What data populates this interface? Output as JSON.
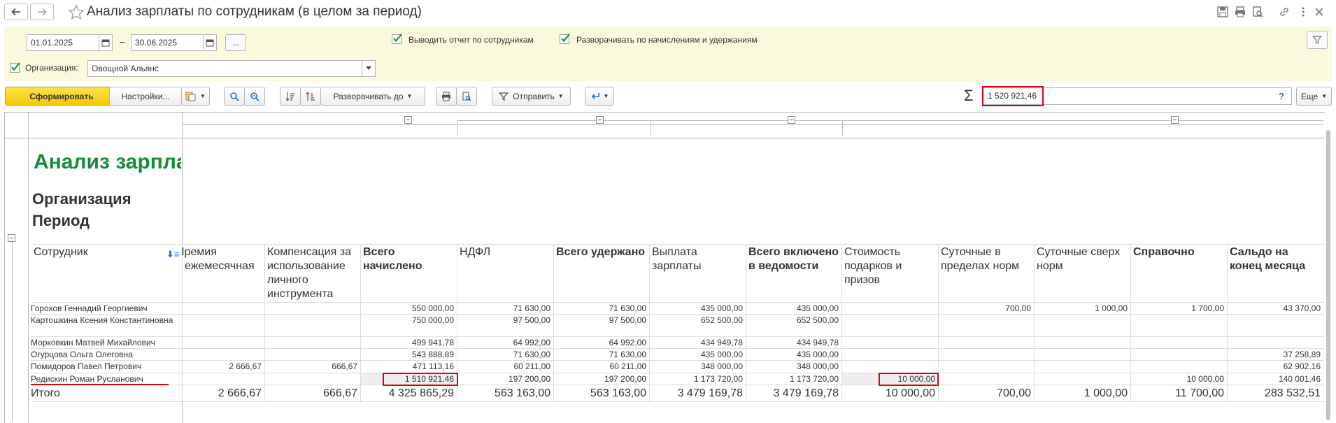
{
  "window": {
    "title": "Анализ зарплаты по сотрудникам (в целом за период)"
  },
  "params": {
    "date_from": "01.01.2025",
    "dash": "–",
    "date_to": "30.06.2025",
    "period_btn": "...",
    "by_employees": {
      "label": "Выводить отчет по сотрудникам",
      "checked": true
    },
    "expand_accruals": {
      "label": "Разворачивать по начислениям и удержаниям",
      "checked": true
    },
    "organization": {
      "label": "Организация:",
      "checked": true,
      "value": "Овощной Альянс"
    }
  },
  "toolbar": {
    "generate": "Сформировать",
    "settings": "Настройки...",
    "expand_to": "Разворачивать до",
    "send": "Отправить",
    "more": "Еще",
    "sum_symbol": "Σ",
    "sum_value": "1 520 921,46",
    "help": "?"
  },
  "report": {
    "title": "Анализ зарпла",
    "org_label": "Организация",
    "period_label": "Период",
    "columns": [
      "Сотрудник",
      "Премия ежемесячная",
      "Компенсация за использование личного инструмента",
      "Всего начислено",
      "НДФЛ",
      "Всего удержано",
      "Выплата зарплаты",
      "Всего включено в ведомости",
      "Стоимость подарков и призов",
      "Суточные в пределах норм",
      "Суточные сверх норм",
      "Справочно",
      "Сальдо на конец месяца"
    ],
    "bold_columns": [
      3,
      5,
      7,
      11,
      12
    ],
    "rows": [
      {
        "name": "Горохов Геннадий Георгиевич",
        "values": [
          "",
          "",
          "550 000,00",
          "71 630,00",
          "71 630,00",
          "435 000,00",
          "435 000,00",
          "",
          "700,00",
          "1 000,00",
          "1 700,00",
          "43 370,00"
        ]
      },
      {
        "name": "Картошкина Ксения Константиновна",
        "values": [
          "",
          "",
          "750 000,00",
          "97 500,00",
          "97 500,00",
          "652 500,00",
          "652 500,00",
          "",
          "",
          "",
          "",
          ""
        ]
      },
      {
        "name": "Морковкин Матвей Михайлович",
        "values": [
          "",
          "",
          "499 941,78",
          "64 992,00",
          "64 992,00",
          "434 949,78",
          "434 949,78",
          "",
          "",
          "",
          "",
          ""
        ]
      },
      {
        "name": "Огурцова Ольга Олеговна",
        "values": [
          "",
          "",
          "543 888,89",
          "71 630,00",
          "71 630,00",
          "435 000,00",
          "435 000,00",
          "",
          "",
          "",
          "",
          "37 258,89"
        ]
      },
      {
        "name": "Помидоров Павел Петрович",
        "values": [
          "2 666,67",
          "666,67",
          "471 113,16",
          "60 211,00",
          "60 211,00",
          "348 000,00",
          "348 000,00",
          "",
          "",
          "",
          "",
          "62 902,16"
        ]
      },
      {
        "name": "Редискин Роман Русланович",
        "values": [
          "",
          "",
          "1 510 921,46",
          "197 200,00",
          "197 200,00",
          "1 173 720,00",
          "1 173 720,00",
          "10 000,00",
          "",
          "",
          "10 000,00",
          "140 001,46"
        ]
      }
    ],
    "total": {
      "name": "Итого",
      "values": [
        "2 666,67",
        "666,67",
        "4 325 865,29",
        "563 163,00",
        "563 163,00",
        "3 479 169,78",
        "3 479 169,78",
        "10 000,00",
        "700,00",
        "1 000,00",
        "11 700,00",
        "283 532,51"
      ]
    }
  },
  "colors": {
    "params_bg": "#fbf9dd",
    "primary_btn": "#f6c800",
    "report_title": "#168c3a",
    "highlight": "#e0000f"
  }
}
